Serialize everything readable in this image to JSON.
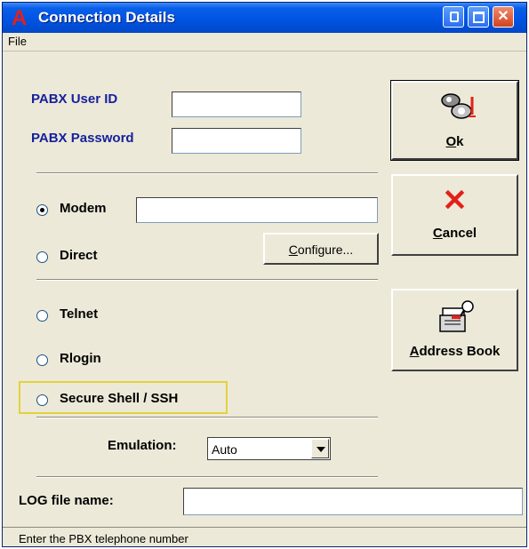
{
  "window": {
    "title": "Connection Details",
    "app_icon": "A",
    "controls": {
      "minimize": "minimize-icon",
      "maximize": "maximize-icon",
      "close": "close-icon"
    }
  },
  "menu": {
    "file": "File"
  },
  "login": {
    "user_id_label": "PABX User ID",
    "user_id_value": "",
    "password_label": "PABX Password",
    "password_value": ""
  },
  "connection": {
    "modem_label": "Modem",
    "modem_value": "",
    "modem_selected": true,
    "direct_label": "Direct",
    "configure_label": "Configure...",
    "telnet_label": "Telnet",
    "rlogin_label": "Rlogin",
    "ssh_label": "Secure Shell / SSH"
  },
  "emulation": {
    "label": "Emulation:",
    "selected": "Auto"
  },
  "log": {
    "label": "LOG file name:",
    "value": ""
  },
  "buttons": {
    "ok_label": "Ok",
    "cancel_label": "Cancel",
    "address_book_label": "Address Book"
  },
  "status": {
    "text": "Enter the PBX telephone number"
  },
  "colors": {
    "title_bar": "#0054e3",
    "blue_label": "#16219c",
    "cancel_x": "#e32019",
    "highlight": "#e3d23c"
  }
}
